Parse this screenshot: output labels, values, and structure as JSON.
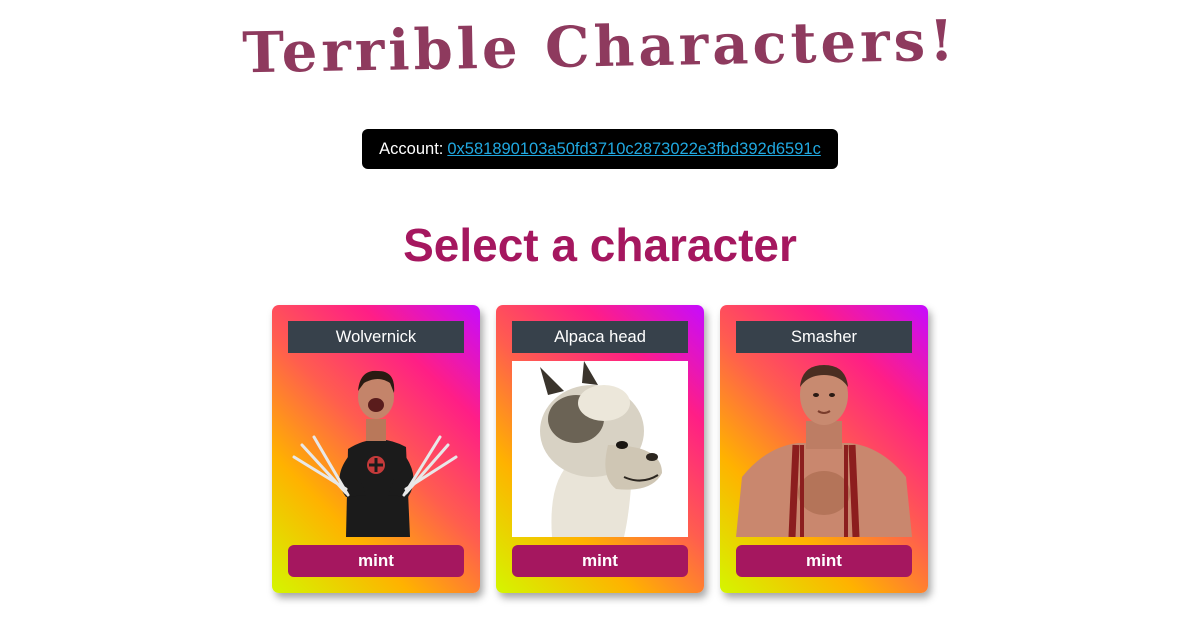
{
  "header": {
    "title": "Terrible Characters!"
  },
  "account": {
    "label": "Account:",
    "address": "0x581890103a50fd3710c2873022e3fbd392d6591c"
  },
  "section": {
    "title": "Select a character"
  },
  "characters": [
    {
      "name": "Wolvernick",
      "button": "mint"
    },
    {
      "name": "Alpaca head",
      "button": "mint"
    },
    {
      "name": "Smasher",
      "button": "mint"
    }
  ],
  "colors": {
    "title": "#8e3a5e",
    "heading": "#a5175f",
    "mint_button": "#a5175f",
    "name_plate": "#37414b",
    "account_bg": "#000000",
    "link": "#20a8e0"
  }
}
